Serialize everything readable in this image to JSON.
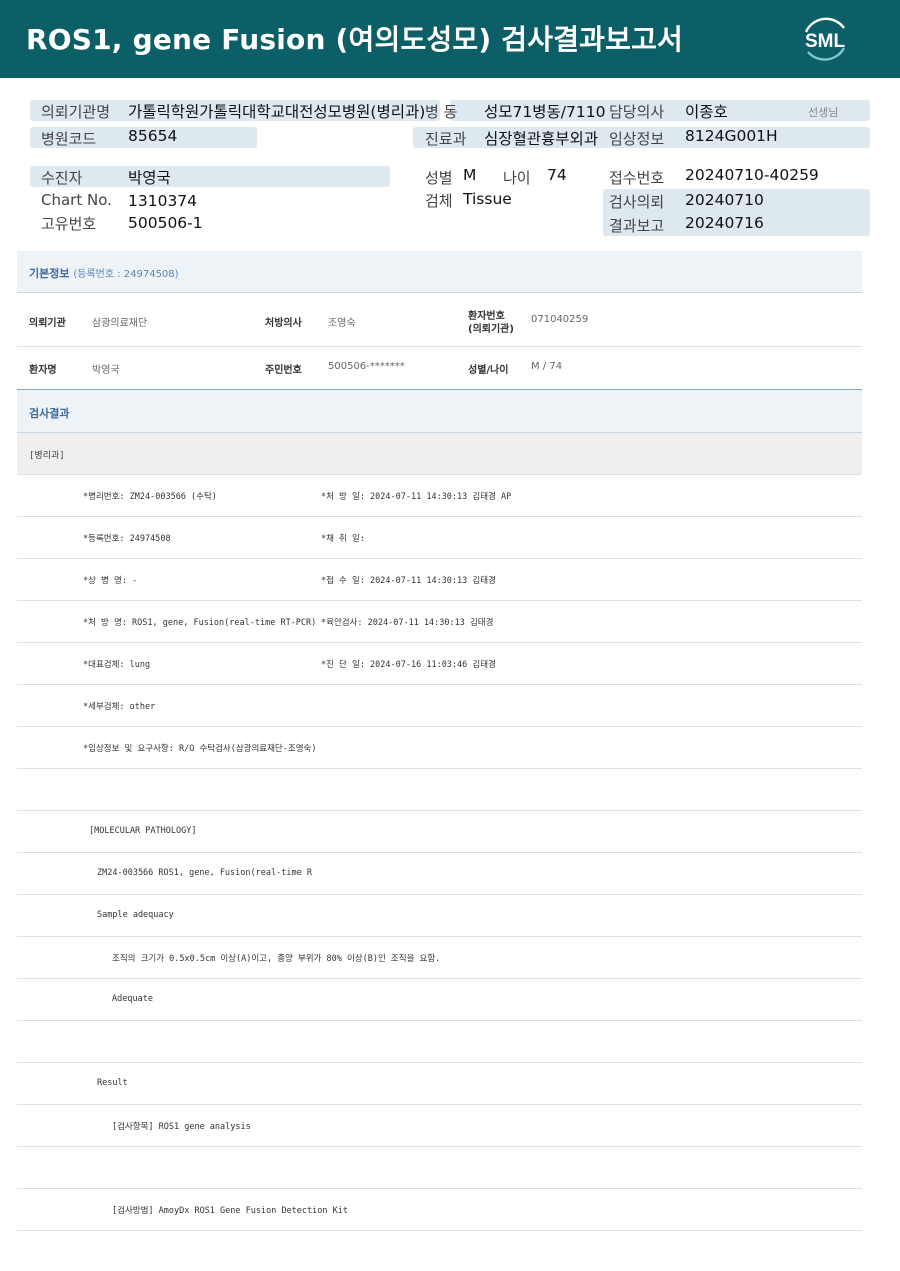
{
  "header": {
    "title": "ROS1, gene Fusion (여의도성모) 검사결과보고서",
    "logo_text": "SML",
    "bg_color": "#0c5f66"
  },
  "info": {
    "institution_label": "의뢰기관명",
    "institution_value": "가톨릭학원가톨릭대학교대전성모병원(병리과)",
    "ward_label": "병  동",
    "ward_value": "성모71병동/7110",
    "doctor_label": "담당의사",
    "doctor_value": "이종호",
    "doctor_suffix": "선생님",
    "hospital_code_label": "병원코드",
    "hospital_code_value": "85654",
    "department_label": "진료과",
    "department_value": "심장혈관흉부외과",
    "clinical_label": "임상정보",
    "clinical_value": "8124G001H",
    "patient_label": "수진자",
    "patient_value": "박영국",
    "sex_label": "성별",
    "sex_value": "M",
    "age_label": "나이",
    "age_value": "74",
    "receipt_label": "접수번호",
    "receipt_value": "20240710-40259",
    "chart_label": "Chart No.",
    "chart_value": "1310374",
    "specimen_label": "검체",
    "specimen_value": "Tissue",
    "request_label": "검사의뢰",
    "request_value": "20240710",
    "unique_label": "고유번호",
    "unique_value": "500506-1",
    "report_label": "결과보고",
    "report_value": "20240716"
  },
  "basic": {
    "title": "기본정보",
    "reg": "(등록번호 : 24974508)",
    "inst_label": "의뢰기관",
    "inst_value": "삼광의료재단",
    "presc_label": "처방의사",
    "presc_value": "조영숙",
    "pno_label_1": "환자번호",
    "pno_label_2": "(의뢰기관)",
    "pno_value": "071040259",
    "name_label": "환자명",
    "name_value": "박영국",
    "rrn_label": "주민번호",
    "rrn_value": "500506-*******",
    "sexage_label": "성별/나이",
    "sexage_value": "M / 74"
  },
  "results": {
    "title": "검사결과",
    "dept": "[병리과]",
    "rows": [
      {
        "left": "*병리번호: ZM24-003566 (수탁)",
        "right": "*처 방 일: 2024-07-11 14:30:13  김태경 AP"
      },
      {
        "left": "*등록번호: 24974508",
        "right": "*채 취 일:"
      },
      {
        "left": "*상 병 명: -",
        "right": "*접 수 일: 2024-07-11 14:30:13  김태경"
      },
      {
        "left": "*처 방 명: ROS1, gene, Fusion(real-time RT-PCR)",
        "right": "*육안검사: 2024-07-11 14:30:13  김태경"
      },
      {
        "left": "*대표검체: lung",
        "right": "*진 단 일: 2024-07-16 11:03:46  김태경"
      },
      {
        "left": "*세부검체: other",
        "right": ""
      },
      {
        "left": "*임상정보 및 요구사항: R/O 수탁검사(삼광의료재단-조영숙)",
        "right": ""
      },
      {
        "left": "",
        "right": ""
      },
      {
        "left": "[MOLECULAR PATHOLOGY]",
        "right": ""
      },
      {
        "left": "ZM24-003566     ROS1, gene, Fusion(real-time R",
        "right": ""
      },
      {
        "left": "Sample adequacy",
        "right": ""
      },
      {
        "left": "조직의 크기가 0.5x0.5cm 이상(A)이고, 종양 부위가 80% 이상(B)인 조직을 요함.",
        "right": ""
      },
      {
        "left": "Adequate",
        "right": ""
      },
      {
        "left": "",
        "right": ""
      },
      {
        "left": "Result",
        "right": ""
      },
      {
        "left": "[검사항목] ROS1 gene analysis",
        "right": ""
      },
      {
        "left": "",
        "right": ""
      },
      {
        "left": "[검사방법] AmoyDx ROS1 Gene Fusion Detection Kit",
        "right": ""
      }
    ]
  }
}
